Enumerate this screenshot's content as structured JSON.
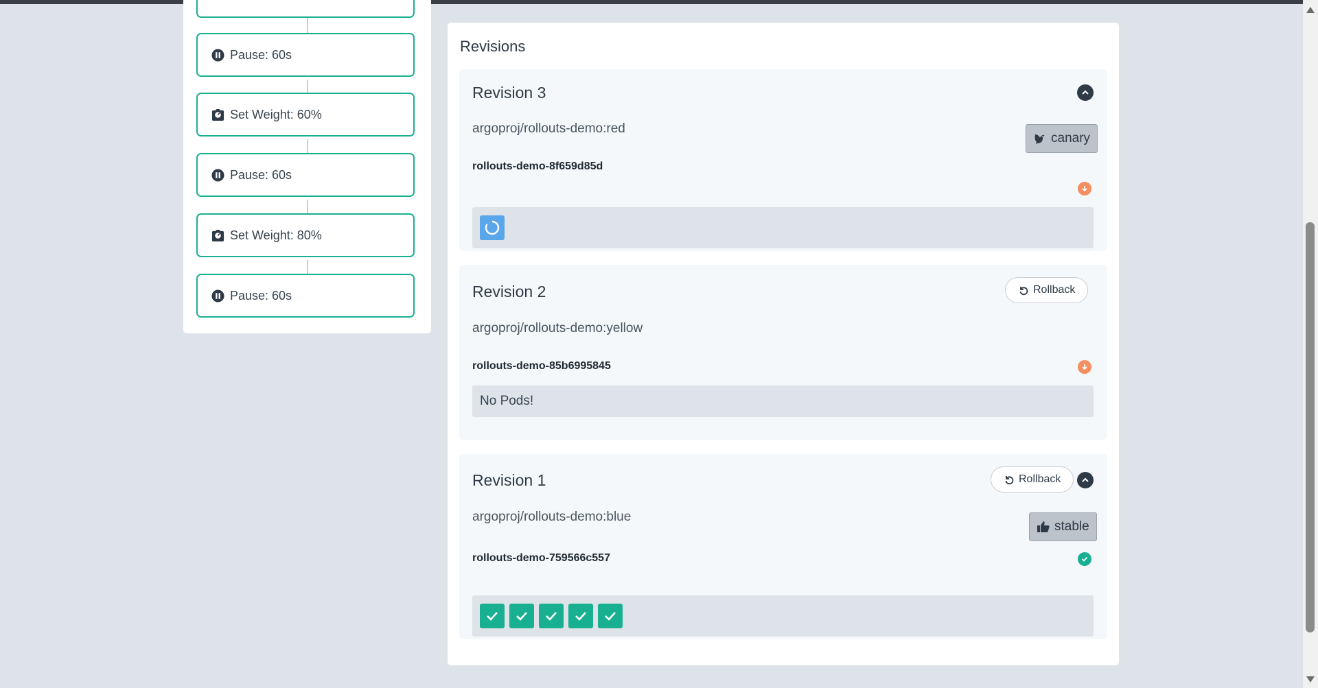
{
  "steps": [
    {
      "label": "Pause: 60s",
      "icon": "pause-icon"
    },
    {
      "label": "Set Weight: 60%",
      "icon": "weight-icon"
    },
    {
      "label": "Pause: 60s",
      "icon": "pause-icon"
    },
    {
      "label": "Set Weight: 80%",
      "icon": "weight-icon"
    },
    {
      "label": "Pause: 60s",
      "icon": "pause-icon"
    }
  ],
  "revisions_panel": {
    "title": "Revisions",
    "revisions": [
      {
        "title": "Revision 3",
        "image": "argoproj/rollouts-demo:red",
        "badge": "canary",
        "replicaset": "rollouts-demo-8f659d85d",
        "pods_state": "progressing",
        "status": "scaled-down"
      },
      {
        "title": "Revision 2",
        "image": "argoproj/rollouts-demo:yellow",
        "rollback_label": "Rollback",
        "replicaset": "rollouts-demo-85b6995845",
        "pods_message": "No Pods!",
        "status": "scaled-down"
      },
      {
        "title": "Revision 1",
        "image": "argoproj/rollouts-demo:blue",
        "badge": "stable",
        "rollback_label": "Rollback",
        "replicaset": "rollouts-demo-759566c557",
        "pods_count": 5,
        "pods_state": "healthy",
        "status": "healthy"
      }
    ]
  },
  "colors": {
    "accent": "#19b092",
    "warning": "#f58e61",
    "progress": "#5aa6ea",
    "background": "#dee3e9"
  }
}
